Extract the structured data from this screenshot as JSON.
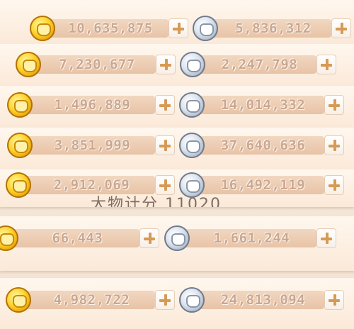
{
  "rows": [
    {
      "gold": "10,635,875",
      "silver": "5,836,312"
    },
    {
      "gold": "7,230,677",
      "silver": "2,247,798"
    },
    {
      "gold": "1,496,889",
      "silver": "14,014,332"
    },
    {
      "gold": "3,851,999",
      "silver": "37,640,636"
    },
    {
      "gold": "2,912,069",
      "silver": "16,492,119"
    },
    {
      "gold": "66,443",
      "silver": "1,661,244"
    },
    {
      "gold": "4,982,722",
      "silver": "24,813,094"
    }
  ],
  "background_text": "大物计分 11020",
  "icons": {
    "gold": "gold-coin-icon",
    "silver": "silver-coin-icon",
    "add": "plus-icon"
  },
  "colors": {
    "value_text": "#c9a893",
    "plus_sign": "#d79a54",
    "pill": "#ecc9ae"
  }
}
